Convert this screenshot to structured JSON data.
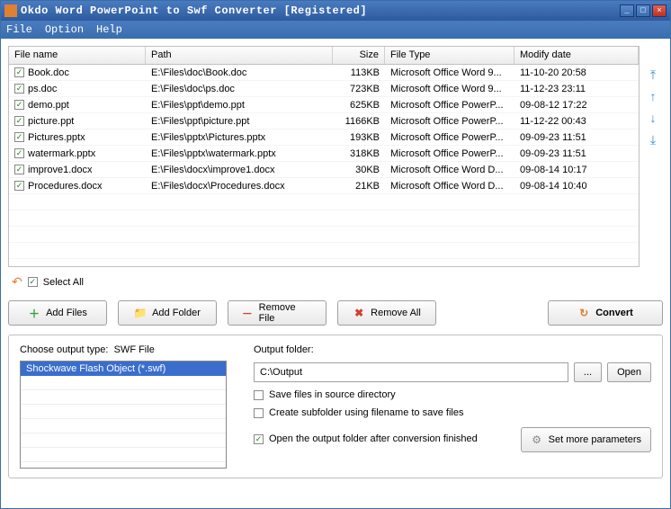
{
  "titlebar": {
    "title": "Okdo Word PowerPoint to Swf Converter [Registered]"
  },
  "menu": {
    "file": "File",
    "option": "Option",
    "help": "Help"
  },
  "columns": {
    "name": "File name",
    "path": "Path",
    "size": "Size",
    "type": "File Type",
    "date": "Modify date"
  },
  "files": [
    {
      "name": "Book.doc",
      "path": "E:\\Files\\doc\\Book.doc",
      "size": "113KB",
      "type": "Microsoft Office Word 9...",
      "date": "11-10-20 20:58"
    },
    {
      "name": "ps.doc",
      "path": "E:\\Files\\doc\\ps.doc",
      "size": "723KB",
      "type": "Microsoft Office Word 9...",
      "date": "11-12-23 23:11"
    },
    {
      "name": "demo.ppt",
      "path": "E:\\Files\\ppt\\demo.ppt",
      "size": "625KB",
      "type": "Microsoft Office PowerP...",
      "date": "09-08-12 17:22"
    },
    {
      "name": "picture.ppt",
      "path": "E:\\Files\\ppt\\picture.ppt",
      "size": "1166KB",
      "type": "Microsoft Office PowerP...",
      "date": "11-12-22 00:43"
    },
    {
      "name": "Pictures.pptx",
      "path": "E:\\Files\\pptx\\Pictures.pptx",
      "size": "193KB",
      "type": "Microsoft Office PowerP...",
      "date": "09-09-23 11:51"
    },
    {
      "name": "watermark.pptx",
      "path": "E:\\Files\\pptx\\watermark.pptx",
      "size": "318KB",
      "type": "Microsoft Office PowerP...",
      "date": "09-09-23 11:51"
    },
    {
      "name": "improve1.docx",
      "path": "E:\\Files\\docx\\improve1.docx",
      "size": "30KB",
      "type": "Microsoft Office Word D...",
      "date": "09-08-14 10:17"
    },
    {
      "name": "Procedures.docx",
      "path": "E:\\Files\\docx\\Procedures.docx",
      "size": "21KB",
      "type": "Microsoft Office Word D...",
      "date": "09-08-14 10:40"
    }
  ],
  "selectall": "Select All",
  "buttons": {
    "addfiles": "Add Files",
    "addfolder": "Add Folder",
    "removefile": "Remove File",
    "removeall": "Remove All",
    "convert": "Convert"
  },
  "output": {
    "type_label": "Choose output type:",
    "type_value": "SWF File",
    "type_item": "Shockwave Flash Object (*.swf)",
    "folder_label": "Output folder:",
    "folder_value": "C:\\Output",
    "browse": "...",
    "open": "Open",
    "save_source": "Save files in source directory",
    "create_sub": "Create subfolder using filename to save files",
    "open_after": "Open the output folder after conversion finished",
    "more_params": "Set more parameters"
  }
}
